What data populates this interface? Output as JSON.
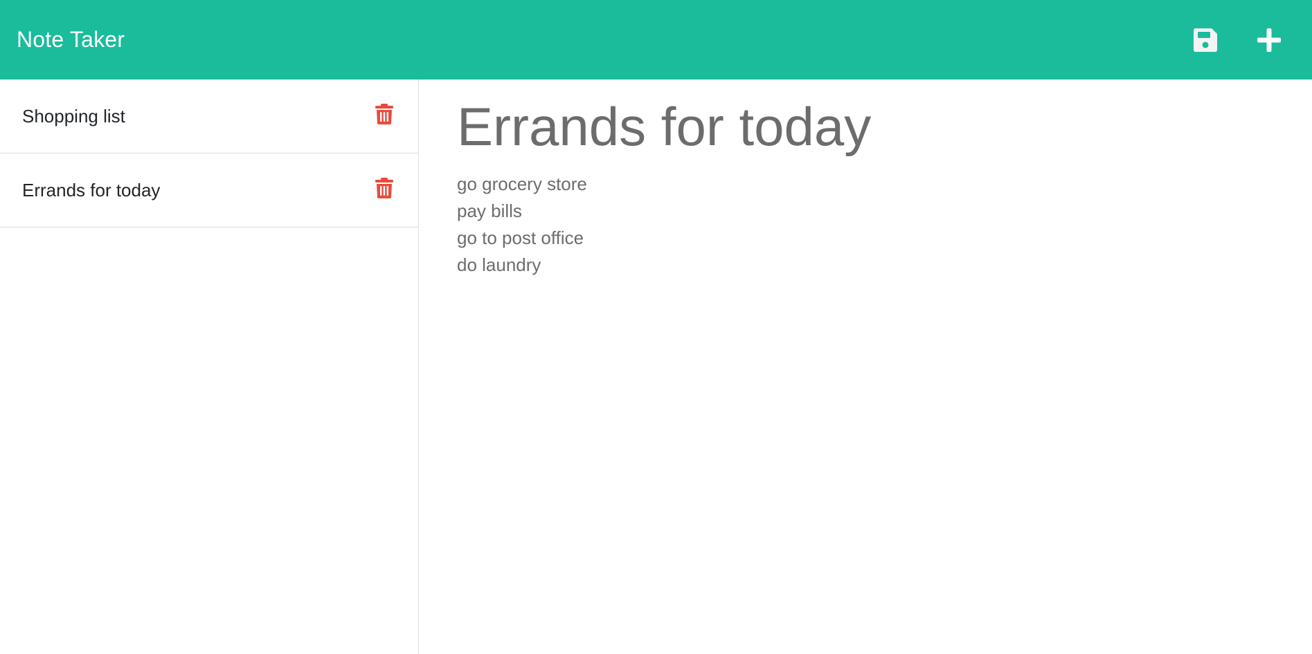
{
  "header": {
    "title": "Note Taker",
    "background_color": "#1abc9c",
    "save_icon": "floppy-disk-icon",
    "new_icon": "plus-icon"
  },
  "sidebar": {
    "notes": [
      {
        "title": "Shopping list",
        "delete_icon": "trash-icon"
      },
      {
        "title": "Errands for today",
        "delete_icon": "trash-icon"
      }
    ],
    "delete_color": "#e74c3c"
  },
  "main": {
    "note_title": "Errands for today",
    "note_lines": [
      "go grocery store",
      "pay bills",
      "go to post office",
      "do laundry"
    ],
    "text_color": "#6c6c6c"
  }
}
